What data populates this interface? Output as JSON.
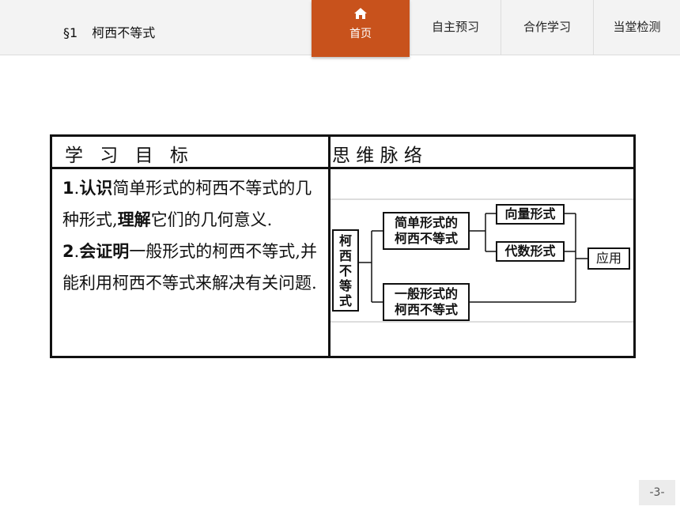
{
  "header": {
    "section_mark": "§1",
    "section_title": "柯西不等式",
    "home_label": "首页",
    "tabs": [
      "自主预习",
      "合作学习",
      "当堂检测"
    ]
  },
  "table": {
    "left_header": "学 习 目 标",
    "right_header": "思 维 脉 络",
    "objectives": {
      "p1_num": "1",
      "p1_dot": ".",
      "p1_verb1": "认识",
      "p1_text1": "简单形式的柯西不等式的几种形式,",
      "p1_verb2": "理解",
      "p1_text2": "它们的几何意义.",
      "p2_num": "2",
      "p2_dot": ".",
      "p2_verb": "会证明",
      "p2_text": "一般形式的柯西不等式,并能利用柯西不等式来解决有关问题."
    },
    "mindmap": {
      "root": "柯西不等式",
      "simple": "简单形式的柯西不等式",
      "simple_line1": "简单形式的",
      "simple_line2": "柯西不等式",
      "general_line1": "一般形式的",
      "general_line2": "柯西不等式",
      "vector": "向量形式",
      "algebra": "代数形式",
      "apply": "应用"
    }
  },
  "page": {
    "number": "-3-"
  },
  "colors": {
    "accent": "#c8521c",
    "nav_bg": "#f3f3f3"
  }
}
